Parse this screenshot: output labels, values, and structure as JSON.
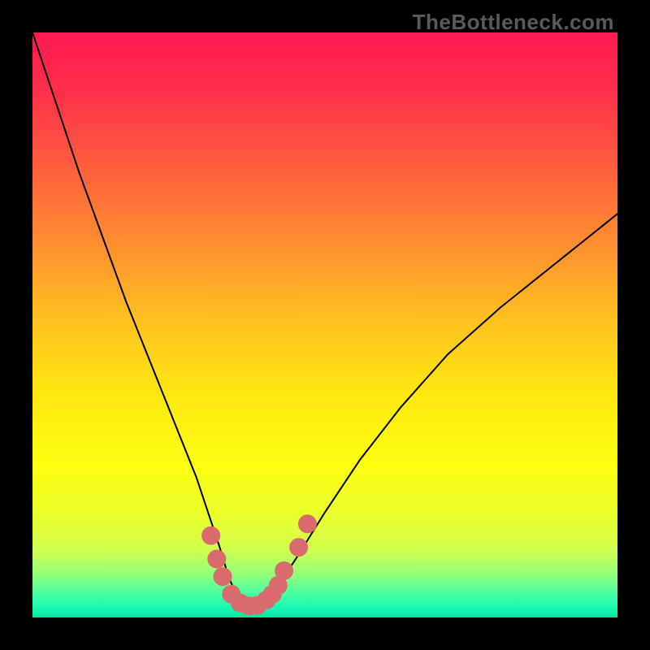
{
  "watermark": "TheBottleneck.com",
  "colors": {
    "gradient_stops": [
      {
        "offset": 0.0,
        "color": "#ff1a50"
      },
      {
        "offset": 0.1,
        "color": "#ff2f4a"
      },
      {
        "offset": 0.22,
        "color": "#ff5b3e"
      },
      {
        "offset": 0.35,
        "color": "#ff8a30"
      },
      {
        "offset": 0.5,
        "color": "#ffc41e"
      },
      {
        "offset": 0.62,
        "color": "#ffe810"
      },
      {
        "offset": 0.74,
        "color": "#fcff10"
      },
      {
        "offset": 0.82,
        "color": "#ecff2a"
      },
      {
        "offset": 0.885,
        "color": "#cfff4e"
      },
      {
        "offset": 0.928,
        "color": "#8fff7a"
      },
      {
        "offset": 0.958,
        "color": "#4bffa2"
      },
      {
        "offset": 0.985,
        "color": "#17f7b5"
      },
      {
        "offset": 1.0,
        "color": "#00e79c"
      }
    ],
    "curve_stroke": "#000000",
    "marker_fill": "#d96a6e"
  },
  "chart_data": {
    "type": "line",
    "title": "",
    "xlabel": "",
    "ylabel": "",
    "xlim": [
      0,
      100
    ],
    "ylim": [
      0,
      100
    ],
    "grid": false,
    "legend": false,
    "series": [
      {
        "name": "bottleneck-curve",
        "x": [
          0,
          4,
          8,
          12,
          16,
          20,
          24,
          28,
          30,
          32,
          33.5,
          35,
          36.5,
          38,
          39.5,
          41,
          45,
          50,
          56,
          63,
          71,
          80,
          90,
          100
        ],
        "y": [
          100,
          88,
          76,
          65,
          54,
          44,
          34,
          24,
          18,
          12,
          7,
          3.5,
          2,
          2,
          2.5,
          4,
          10,
          18,
          27,
          36,
          45,
          53,
          61,
          69
        ]
      }
    ],
    "markers": {
      "name": "highlight-points",
      "style": "circle",
      "radius": 1.6,
      "x": [
        30.5,
        31.5,
        32.5,
        34,
        35.5,
        37,
        38.5,
        40,
        41,
        42,
        43,
        45.5,
        47
      ],
      "y": [
        14,
        10,
        7,
        4,
        2.5,
        2,
        2.1,
        3,
        4,
        5.5,
        8,
        12,
        16
      ]
    }
  }
}
